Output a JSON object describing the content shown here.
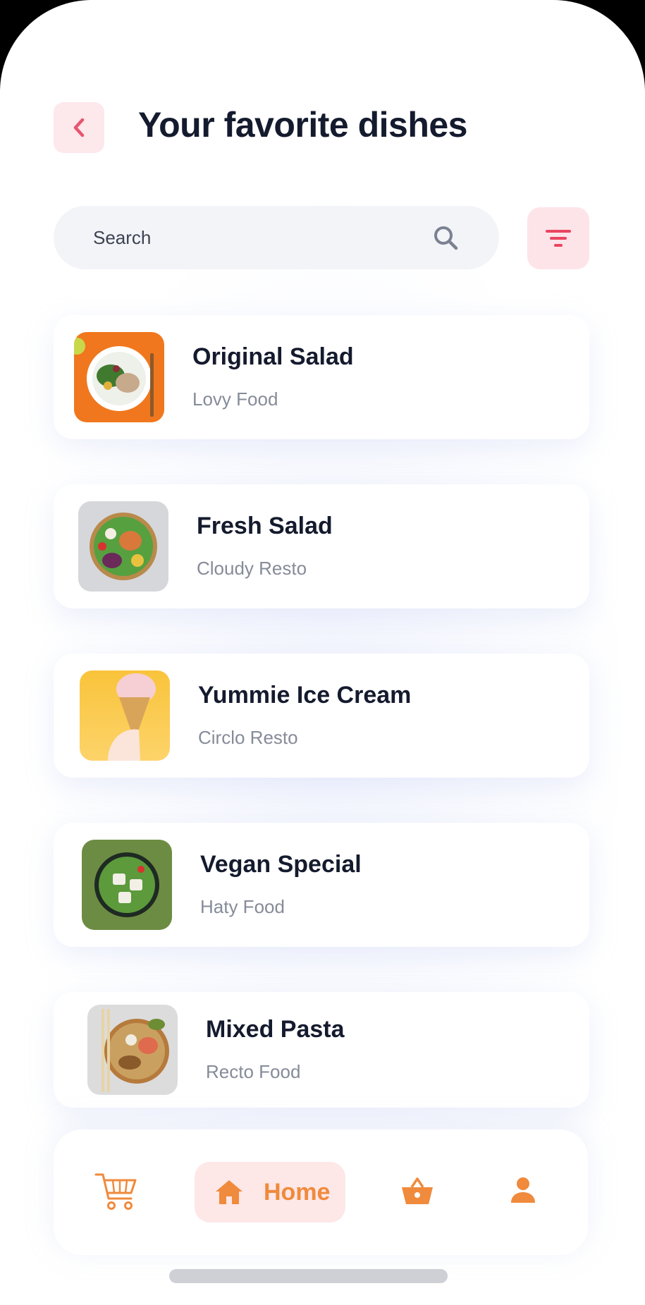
{
  "header": {
    "title": "Your favorite dishes"
  },
  "search": {
    "placeholder": "Search"
  },
  "dishes": [
    {
      "name": "Original Salad",
      "resto": "Lovy Food"
    },
    {
      "name": "Fresh Salad",
      "resto": "Cloudy Resto"
    },
    {
      "name": "Yummie Ice Cream",
      "resto": "Circlo Resto"
    },
    {
      "name": "Vegan Special",
      "resto": "Haty Food"
    },
    {
      "name": "Mixed Pasta",
      "resto": "Recto Food"
    }
  ],
  "nav": {
    "home_label": "Home"
  },
  "colors": {
    "accent": "#f08a3c",
    "back_red": "#e8556e",
    "filter_red": "#ea4560",
    "text_dark": "#151b2e"
  }
}
